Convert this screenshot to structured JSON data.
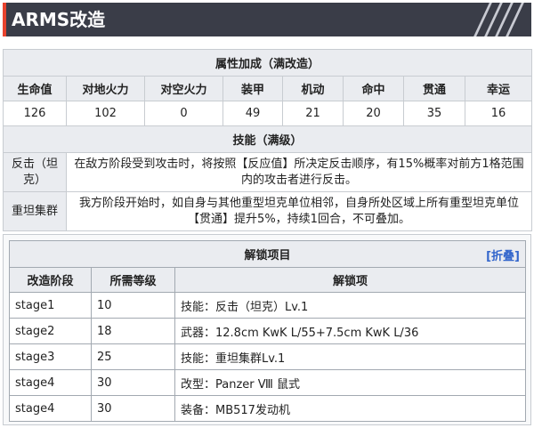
{
  "header": {
    "title": "ARMS改造"
  },
  "stats": {
    "title": "属性加成（满改造）",
    "columns": [
      "生命值",
      "对地火力",
      "对空火力",
      "装甲",
      "机动",
      "命中",
      "贯通",
      "幸运"
    ],
    "values": [
      "126",
      "102",
      "0",
      "49",
      "21",
      "20",
      "35",
      "16"
    ]
  },
  "skills": {
    "title": "技能（满级）",
    "items": [
      {
        "name": "反击（坦克）",
        "desc": "在敌方阶段受到攻击时，将按照【反应值】所决定反击顺序，有15%概率对前方1格范围内的攻击者进行反击。"
      },
      {
        "name": "重坦集群",
        "desc": "我方阶段开始时，如自身与其他重型坦克单位相邻，自身所处区域上所有重型坦克单位【贯通】提升5%，持续1回合，不可叠加。"
      }
    ]
  },
  "unlock": {
    "title": "解锁项目",
    "fold_label": "[折叠]",
    "columns": [
      "改造阶段",
      "所需等级",
      "解锁项"
    ],
    "rows": [
      [
        "stage1",
        "10",
        "技能：反击（坦克）Lv.1"
      ],
      [
        "stage2",
        "18",
        "武器：12.8cm KwK L/55+7.5cm KwK L/36"
      ],
      [
        "stage3",
        "25",
        "技能：重坦集群Lv.1"
      ],
      [
        "stage4",
        "30",
        "改型：Panzer Ⅷ 鼠式"
      ],
      [
        "stage4",
        "30",
        "装备：MB517发动机"
      ]
    ]
  }
}
